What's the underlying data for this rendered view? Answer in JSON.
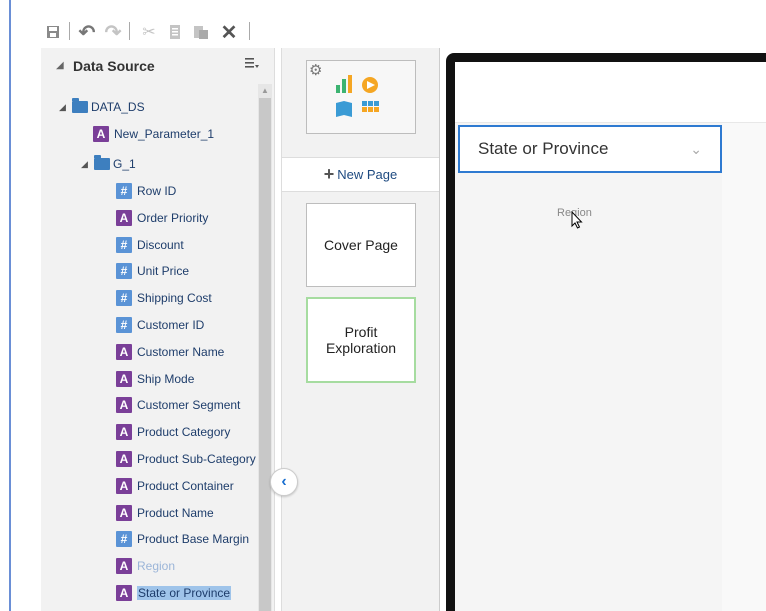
{
  "toolbar": {
    "items": [
      {
        "name": "save-icon",
        "glyph": "💾"
      },
      {
        "name": "undo-icon",
        "glyph": "↶"
      },
      {
        "name": "redo-icon",
        "glyph": "↷"
      },
      {
        "name": "cut-icon",
        "glyph": "✂"
      },
      {
        "name": "copy-icon",
        "glyph": "⧉"
      },
      {
        "name": "paste-icon",
        "glyph": "📋"
      },
      {
        "name": "delete-icon",
        "glyph": "✕"
      }
    ]
  },
  "data_source": {
    "title": "Data Source",
    "root": "DATA_DS",
    "parameter": "New_Parameter_1",
    "group": "G_1",
    "fields": [
      {
        "type": "#",
        "label": "Row ID"
      },
      {
        "type": "A",
        "label": "Order Priority"
      },
      {
        "type": "#",
        "label": "Discount"
      },
      {
        "type": "#",
        "label": "Unit Price"
      },
      {
        "type": "#",
        "label": "Shipping Cost"
      },
      {
        "type": "#",
        "label": "Customer ID"
      },
      {
        "type": "A",
        "label": "Customer Name"
      },
      {
        "type": "A",
        "label": "Ship Mode"
      },
      {
        "type": "A",
        "label": "Customer Segment"
      },
      {
        "type": "A",
        "label": "Product Category"
      },
      {
        "type": "A",
        "label": "Product Sub-Category"
      },
      {
        "type": "A",
        "label": "Product Container"
      },
      {
        "type": "A",
        "label": "Product Name"
      },
      {
        "type": "#",
        "label": "Product Base Margin"
      },
      {
        "type": "A",
        "label": "Region",
        "state": "disabled"
      },
      {
        "type": "A",
        "label": "State or Province",
        "state": "selected"
      }
    ]
  },
  "pages": {
    "new_page_label": "New Page",
    "items": [
      "Cover Page",
      "Profit Exploration"
    ]
  },
  "canvas": {
    "filter_label": "State or Province",
    "drag_label": "Region"
  },
  "colors": {
    "accent": "#2e7ad1",
    "attr_badge": "#7a3f98",
    "num_badge": "#5a93d6"
  }
}
